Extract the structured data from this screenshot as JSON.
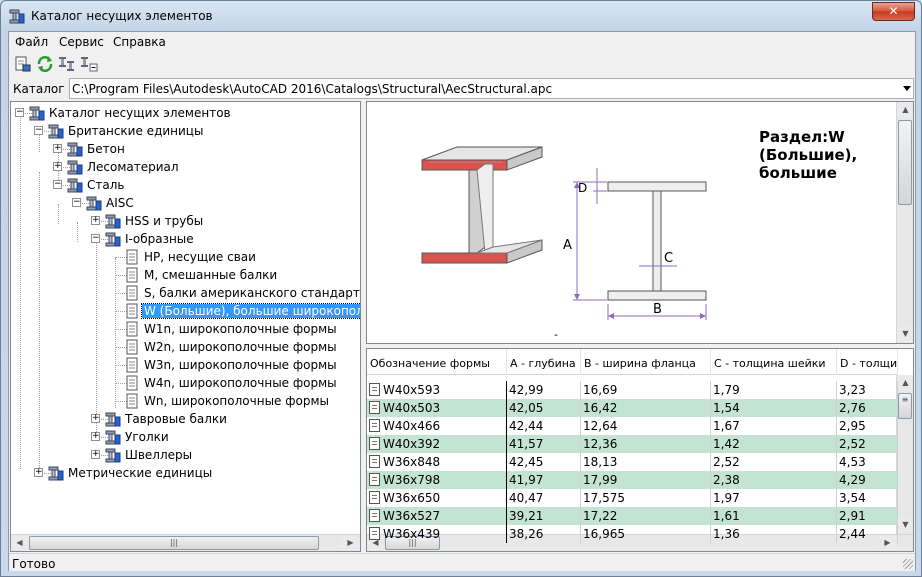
{
  "window": {
    "title": "Каталог несущих элементов",
    "close_label": "✕"
  },
  "menu": {
    "items": [
      {
        "label": "Файл"
      },
      {
        "label": "Сервис"
      },
      {
        "label": "Справка"
      }
    ]
  },
  "catalog": {
    "label": "Каталог",
    "path": "C:\\Program Files\\Autodesk\\AutoCAD 2016\\Catalogs\\Structural\\AecStructural.apc"
  },
  "tree": {
    "nodes": [
      {
        "label": "Каталог несущих элементов",
        "exp": "−"
      },
      {
        "label": "Британские единицы",
        "exp": "−"
      },
      {
        "label": "Бетон",
        "exp": "+"
      },
      {
        "label": "Лесоматериал",
        "exp": "+"
      },
      {
        "label": "Сталь",
        "exp": "−"
      },
      {
        "label": "AISC",
        "exp": "−"
      },
      {
        "label": "HSS и трубы",
        "exp": "+"
      },
      {
        "label": "I-образные",
        "exp": "−"
      },
      {
        "label": "HP, несущие сваи"
      },
      {
        "label": "M, смешанные балки"
      },
      {
        "label": "S, балки американского стандарта"
      },
      {
        "label": "W (Большие), большие широкополо"
      },
      {
        "label": "W1n, широкополочные формы"
      },
      {
        "label": "W2n, широкополочные формы"
      },
      {
        "label": "W3n, широкополочные формы"
      },
      {
        "label": "W4n, широкополочные формы"
      },
      {
        "label": "Wn, широкополочные формы"
      },
      {
        "label": "Тавровые балки",
        "exp": "+"
      },
      {
        "label": "Уголки",
        "exp": "+"
      },
      {
        "label": "Швеллеры",
        "exp": "+"
      },
      {
        "label": "Метрические единицы",
        "exp": "+"
      }
    ]
  },
  "preview": {
    "section_title": "Раздел:W (Большие), большие",
    "dim_a": "A",
    "dim_b": "B",
    "dim_c": "C",
    "dim_d": "D",
    "caption": "-"
  },
  "grid": {
    "columns": [
      "Обозначение формы",
      "A - глубина",
      "B - ширина фланца",
      "C - толщина шейки",
      "D - толщина"
    ],
    "rows": [
      [
        "W40x593",
        "42,99",
        "16,69",
        "1,79",
        "3,23"
      ],
      [
        "W40x503",
        "42,05",
        "16,42",
        "1,54",
        "2,76"
      ],
      [
        "W40x466",
        "42,44",
        "12,64",
        "1,67",
        "2,95"
      ],
      [
        "W40x392",
        "41,57",
        "12,36",
        "1,42",
        "2,52"
      ],
      [
        "W36x848",
        "42,45",
        "18,13",
        "2,52",
        "4,53"
      ],
      [
        "W36x798",
        "41,97",
        "17,99",
        "2,38",
        "4,29"
      ],
      [
        "W36x650",
        "40,47",
        "17,575",
        "1,97",
        "3,54"
      ],
      [
        "W36x527",
        "39,21",
        "17,22",
        "1,61",
        "2,91"
      ],
      [
        "W36x439",
        "38,26",
        "16,965",
        "1,36",
        "2,44"
      ]
    ]
  },
  "status": {
    "text": "Готово"
  },
  "colors": {
    "selection": "#3399ff",
    "row_alt": "#c3e3d3",
    "beam_flange": "#d9534f"
  }
}
